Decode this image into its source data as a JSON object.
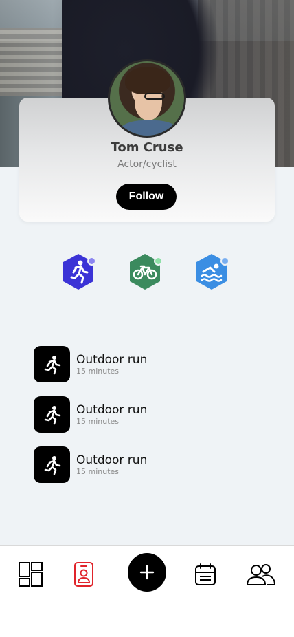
{
  "profile": {
    "name": "Tom Cruse",
    "role": "Actor/cyclist",
    "follow_label": "Follow"
  },
  "activities": [
    {
      "icon": "running-icon",
      "color": "#3b33d6",
      "dot_color": "#8c86f0"
    },
    {
      "icon": "bicycle-icon",
      "color": "#3b8a5e",
      "dot_color": "#8fe0a8"
    },
    {
      "icon": "swimming-icon",
      "color": "#3b8ee3",
      "dot_color": "#78aef0"
    }
  ],
  "workouts": [
    {
      "title": "Outdoor run",
      "duration": "15 minutes",
      "icon": "running-icon"
    },
    {
      "title": "Outdoor run",
      "duration": "15 minutes",
      "icon": "running-icon"
    },
    {
      "title": "Outdoor run",
      "duration": "15 minutes",
      "icon": "running-icon"
    }
  ],
  "nav": {
    "items": [
      "dashboard-icon",
      "profile-badge-icon",
      "add-icon",
      "calendar-icon",
      "people-icon"
    ],
    "active": "profile-badge-icon",
    "active_color": "#e0242b"
  },
  "colors": {
    "background": "#eff3f6",
    "accent": "#000000"
  }
}
